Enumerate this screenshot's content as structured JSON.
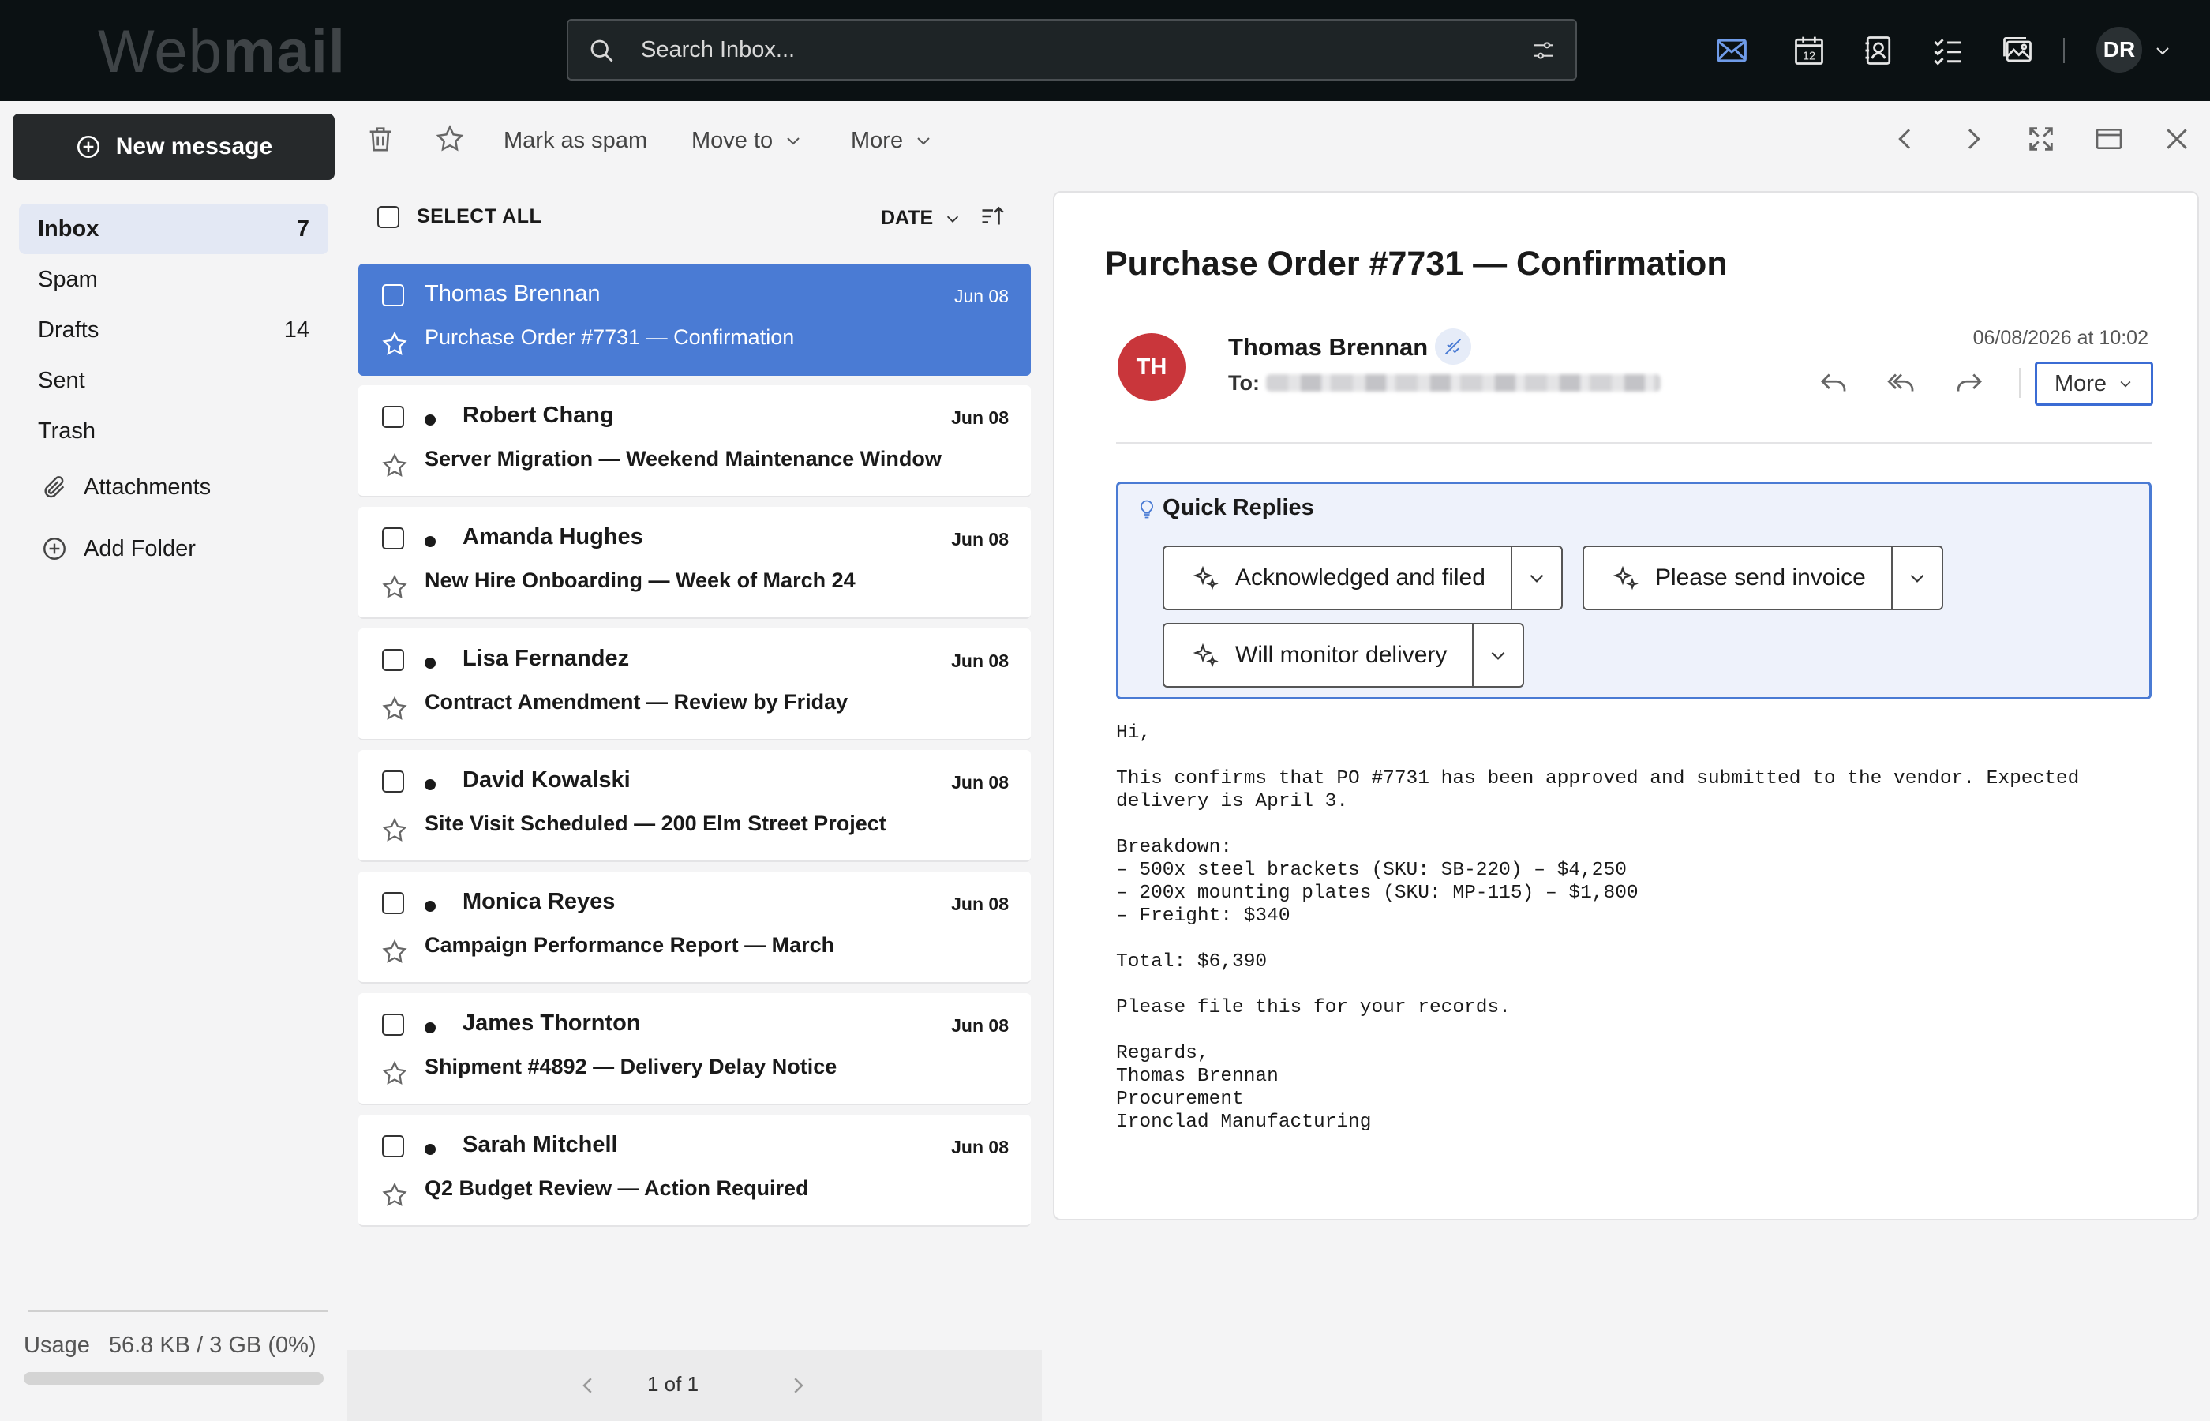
{
  "app": {
    "logo_light": "Web",
    "logo_bold": "mail"
  },
  "search": {
    "placeholder": "Search Inbox..."
  },
  "topnav": {
    "icons": [
      "mail-icon",
      "calendar-icon",
      "contacts-icon",
      "tasks-icon",
      "photos-icon"
    ],
    "calendar_day": "12",
    "user_initials": "DR",
    "accent": "#4a7bd4"
  },
  "sidebar": {
    "new_message_label": "New message",
    "folders": [
      {
        "label": "Inbox",
        "count": "7"
      },
      {
        "label": "Spam",
        "count": ""
      },
      {
        "label": "Drafts",
        "count": "14"
      },
      {
        "label": "Sent",
        "count": ""
      },
      {
        "label": "Trash",
        "count": ""
      }
    ],
    "attachments_label": "Attachments",
    "add_folder_label": "Add Folder",
    "usage_label": "Usage",
    "usage_value": "56.8 KB / 3 GB (0%)",
    "usage_fraction": 0.0
  },
  "toolbar": {
    "mark_spam_label": "Mark as spam",
    "move_to_label": "Move to",
    "more_label": "More"
  },
  "list": {
    "select_all_label": "SELECT ALL",
    "sort_label": "DATE",
    "items": [
      {
        "sender": "Thomas Brennan",
        "subject": "Purchase Order #7731 — Confirmation",
        "date": "Jun 08",
        "unread": false,
        "selected": true
      },
      {
        "sender": "Robert Chang",
        "subject": "Server Migration — Weekend Maintenance Window",
        "date": "Jun 08",
        "unread": true,
        "selected": false
      },
      {
        "sender": "Amanda Hughes",
        "subject": "New Hire Onboarding — Week of March 24",
        "date": "Jun 08",
        "unread": true,
        "selected": false
      },
      {
        "sender": "Lisa Fernandez",
        "subject": "Contract Amendment — Review by Friday",
        "date": "Jun 08",
        "unread": true,
        "selected": false
      },
      {
        "sender": "David Kowalski",
        "subject": "Site Visit Scheduled — 200 Elm Street Project",
        "date": "Jun 08",
        "unread": true,
        "selected": false
      },
      {
        "sender": "Monica Reyes",
        "subject": "Campaign Performance Report — March",
        "date": "Jun 08",
        "unread": true,
        "selected": false
      },
      {
        "sender": "James Thornton",
        "subject": "Shipment #4892 — Delivery Delay Notice",
        "date": "Jun 08",
        "unread": true,
        "selected": false
      },
      {
        "sender": "Sarah Mitchell",
        "subject": "Q2 Budget Review — Action Required",
        "date": "Jun 08",
        "unread": true,
        "selected": false
      }
    ],
    "pager_text": "1 of 1"
  },
  "message": {
    "subject": "Purchase Order #7731 — Confirmation",
    "avatar_initials": "TH",
    "avatar_color": "#c9363b",
    "sender": "Thomas Brennan",
    "to_label": "To:",
    "datetime": "06/08/2026 at 10:02",
    "more_label": "More",
    "quick_replies_title": "Quick Replies",
    "quick_replies": [
      "Acknowledged and filed",
      "Please send invoice",
      "Will monitor delivery"
    ],
    "body": "Hi,\n\nThis confirms that PO #7731 has been approved and submitted to the vendor. Expected\ndelivery is April 3.\n\nBreakdown:\n– 500x steel brackets (SKU: SB-220) – $4,250\n– 200x mounting plates (SKU: MP-115) – $1,800\n– Freight: $340\n\nTotal: $6,390\n\nPlease file this for your records.\n\nRegards,\nThomas Brennan\nProcurement\nIronclad Manufacturing"
  }
}
